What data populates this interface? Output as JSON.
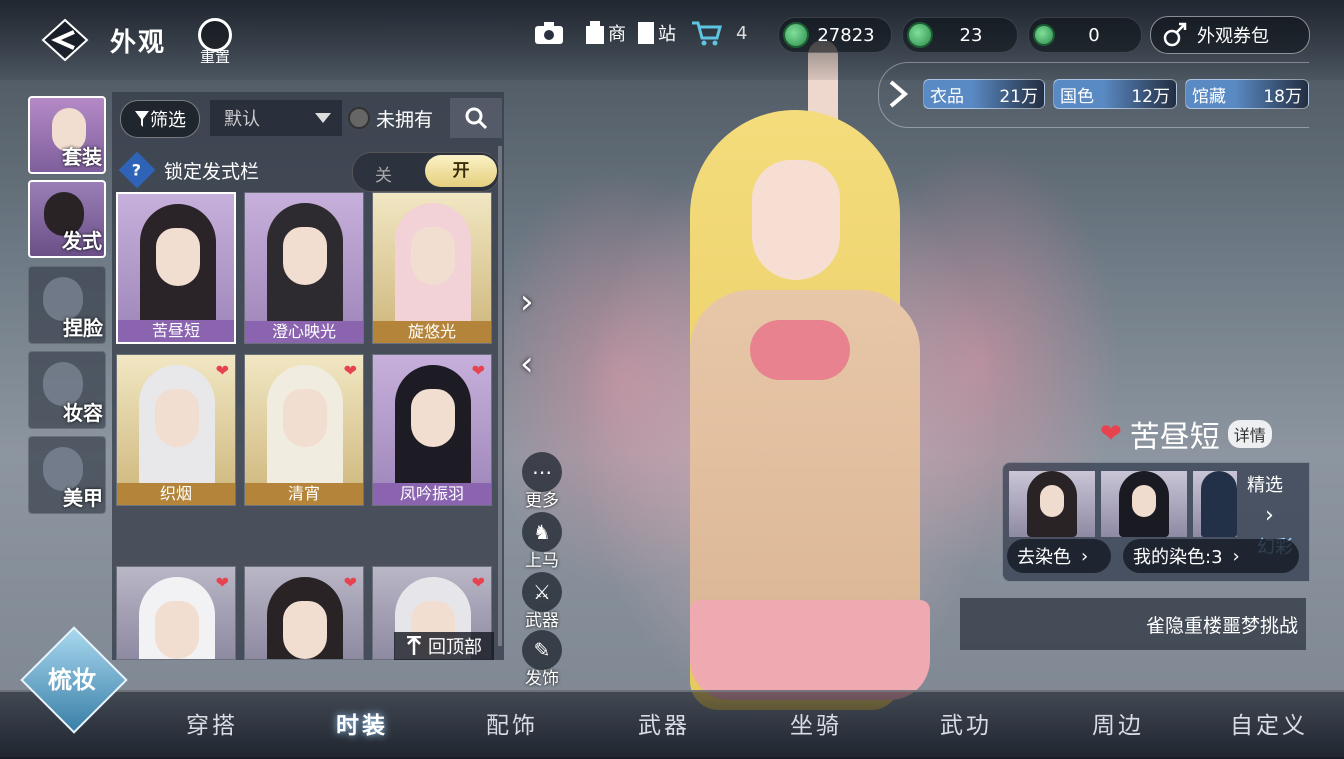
{
  "header": {
    "title": "外观",
    "reset_label": "重置",
    "icons": [
      {
        "name": "camera-icon",
        "label": ""
      },
      {
        "name": "shop-icon",
        "label": "商"
      },
      {
        "name": "station-icon",
        "label": "站"
      },
      {
        "name": "cart-icon",
        "label": "4"
      }
    ],
    "currencies": [
      {
        "icon": "jade-coin-icon",
        "value": "27823"
      },
      {
        "icon": "jade-coin-icon",
        "value": "23"
      },
      {
        "icon": "jade-coin-small-icon",
        "value": "0"
      }
    ],
    "voucher_label": "外观券包"
  },
  "ranks": [
    {
      "label": "衣品",
      "value": "21万"
    },
    {
      "label": "国色",
      "value": "12万"
    },
    {
      "label": "馆藏",
      "value": "18万"
    }
  ],
  "categories": [
    {
      "label": "套装",
      "selected": false
    },
    {
      "label": "发式",
      "selected": true
    },
    {
      "label": "捏脸",
      "selected": false
    },
    {
      "label": "妆容",
      "selected": false
    },
    {
      "label": "美甲",
      "selected": false
    }
  ],
  "panel": {
    "filter_label": "筛选",
    "sort_value": "默认",
    "owned_label": "未拥有",
    "lock_label": "锁定发式栏",
    "toggle_off": "关",
    "toggle_on": "开",
    "back_to_top": "回顶部",
    "cards": [
      {
        "name": "苦昼短",
        "tier": "purple",
        "hair": "#2a2428",
        "selected": true
      },
      {
        "name": "澄心映光",
        "tier": "purple",
        "hair": "#2d2a30",
        "selected": false
      },
      {
        "name": "旋悠光",
        "tier": "gold",
        "hair": "#f2d2d6",
        "selected": false
      },
      {
        "name": "织烟",
        "tier": "gold",
        "hair": "#e8e8ea",
        "selected": false
      },
      {
        "name": "清宵",
        "tier": "gold",
        "hair": "#f1ece0",
        "selected": false
      },
      {
        "name": "凤吟振羽",
        "tier": "purple",
        "hair": "#1d1c24",
        "selected": false
      },
      {
        "name": "",
        "tier": "plain",
        "hair": "#f2f2f4",
        "selected": false
      },
      {
        "name": "",
        "tier": "plain",
        "hair": "#2a2326",
        "selected": false
      },
      {
        "name": "",
        "tier": "plain",
        "hair": "#e6e6ea",
        "selected": false
      }
    ]
  },
  "actions": [
    {
      "icon": "more-icon",
      "label": "更多"
    },
    {
      "icon": "horse-icon",
      "label": "上马"
    },
    {
      "icon": "sword-icon",
      "label": "武器"
    },
    {
      "icon": "hairpin-icon",
      "label": "发饰"
    }
  ],
  "outfit": {
    "name": "苦昼短",
    "detail_label": "详情",
    "featured_label": "精选",
    "rainbow_label": "幻彩",
    "remove_dye_label": "去染色",
    "my_dye_label": "我的染色:3",
    "challenge_label": "雀隐重楼噩梦挑战"
  },
  "groom_label": "梳妆",
  "nav_tabs": [
    {
      "label": "穿搭",
      "active": false
    },
    {
      "label": "时装",
      "active": true
    },
    {
      "label": "配饰",
      "active": false
    },
    {
      "label": "武器",
      "active": false
    },
    {
      "label": "坐骑",
      "active": false
    },
    {
      "label": "武功",
      "active": false
    },
    {
      "label": "周边",
      "active": false
    },
    {
      "label": "自定义",
      "active": false
    }
  ],
  "colors": {
    "accent": "#e4cf7e",
    "heart": "#e8424f",
    "purple_tier": "#8b64b0",
    "gold_tier": "#b3843a"
  }
}
